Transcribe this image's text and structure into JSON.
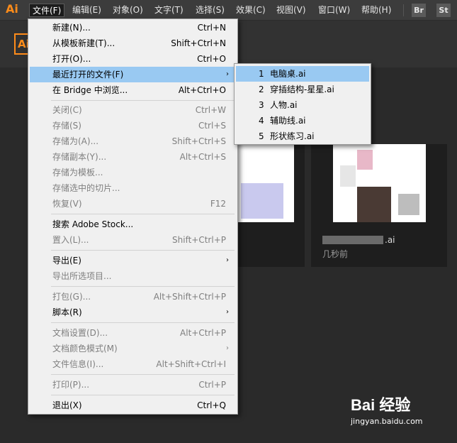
{
  "app": {
    "logo": "Ai",
    "logo_color": "#ff8c1a"
  },
  "menubar": {
    "items": [
      {
        "label": "文件(F)"
      },
      {
        "label": "编辑(E)"
      },
      {
        "label": "对象(O)"
      },
      {
        "label": "文字(T)"
      },
      {
        "label": "选择(S)"
      },
      {
        "label": "效果(C)"
      },
      {
        "label": "视图(V)"
      },
      {
        "label": "窗口(W)"
      },
      {
        "label": "帮助(H)"
      }
    ],
    "switchers": [
      "Br",
      "St"
    ]
  },
  "workspace": {
    "badge": "Ai",
    "cards": [
      {
        "name": "",
        "time": ""
      },
      {
        "name": ".ai",
        "time": "几秒前"
      }
    ]
  },
  "file_menu": {
    "items": [
      {
        "label": "新建(N)...",
        "shortcut": "Ctrl+N",
        "enabled": true
      },
      {
        "label": "从模板新建(T)...",
        "shortcut": "Shift+Ctrl+N",
        "enabled": true
      },
      {
        "label": "打开(O)...",
        "shortcut": "Ctrl+O",
        "enabled": true
      },
      {
        "label": "最近打开的文件(F)",
        "shortcut": "",
        "enabled": true,
        "submenu": true
      },
      {
        "label": "在 Bridge 中浏览...",
        "shortcut": "Alt+Ctrl+O",
        "enabled": true
      },
      {
        "label": "关闭(C)",
        "shortcut": "Ctrl+W",
        "enabled": false
      },
      {
        "label": "存储(S)",
        "shortcut": "Ctrl+S",
        "enabled": false
      },
      {
        "label": "存储为(A)...",
        "shortcut": "Shift+Ctrl+S",
        "enabled": false
      },
      {
        "label": "存储副本(Y)...",
        "shortcut": "Alt+Ctrl+S",
        "enabled": false
      },
      {
        "label": "存储为模板...",
        "shortcut": "",
        "enabled": false
      },
      {
        "label": "存储选中的切片...",
        "shortcut": "",
        "enabled": false
      },
      {
        "label": "恢复(V)",
        "shortcut": "F12",
        "enabled": false
      },
      {
        "label": "搜索 Adobe Stock...",
        "shortcut": "",
        "enabled": true
      },
      {
        "label": "置入(L)...",
        "shortcut": "Shift+Ctrl+P",
        "enabled": false
      },
      {
        "label": "导出(E)",
        "shortcut": "",
        "enabled": true,
        "submenu": true
      },
      {
        "label": "导出所选项目...",
        "shortcut": "",
        "enabled": false
      },
      {
        "label": "打包(G)...",
        "shortcut": "Alt+Shift+Ctrl+P",
        "enabled": false
      },
      {
        "label": "脚本(R)",
        "shortcut": "",
        "enabled": true,
        "submenu": true
      },
      {
        "label": "文档设置(D)...",
        "shortcut": "Alt+Ctrl+P",
        "enabled": false
      },
      {
        "label": "文档颜色模式(M)",
        "shortcut": "",
        "enabled": false,
        "submenu": true
      },
      {
        "label": "文件信息(I)...",
        "shortcut": "Alt+Shift+Ctrl+I",
        "enabled": false
      },
      {
        "label": "打印(P)...",
        "shortcut": "Ctrl+P",
        "enabled": false
      },
      {
        "label": "退出(X)",
        "shortcut": "Ctrl+Q",
        "enabled": true
      }
    ],
    "submenu_arrow": "›"
  },
  "recent_files": {
    "items": [
      {
        "num": "1",
        "label": "电脑桌.ai"
      },
      {
        "num": "2",
        "label": "穿插结构-星星.ai"
      },
      {
        "num": "3",
        "label": "人物.ai"
      },
      {
        "num": "4",
        "label": "辅助线.ai"
      },
      {
        "num": "5",
        "label": "形状练习.ai"
      }
    ]
  },
  "watermark": {
    "brand": "Bai  经验",
    "url": "jingyan.baidu.com"
  },
  "colors": {
    "highlight": "#99c9f2",
    "menu_bg": "#f0f0f0",
    "bar_bg": "#3c3c3c"
  }
}
